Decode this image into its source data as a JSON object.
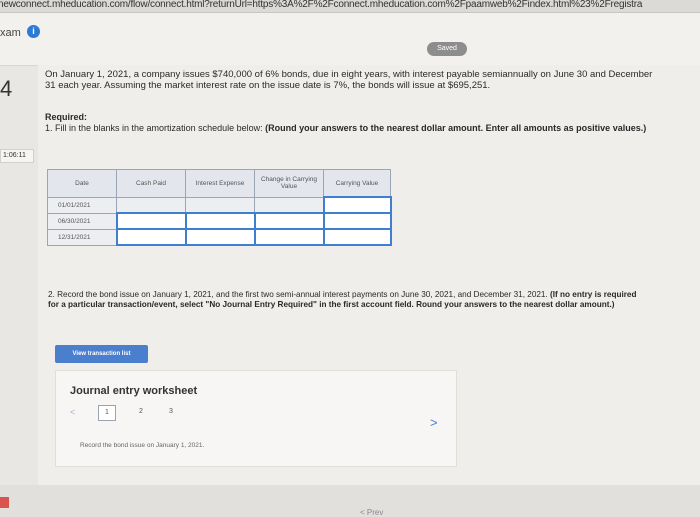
{
  "browser": {
    "url": "newconnect.mheducation.com/flow/connect.html?returnUrl=https%3A%2F%2Fconnect.mheducation.com%2Fpaamweb%2Findex.html%23%2Fregistra"
  },
  "header": {
    "exam_label": "xam",
    "info_icon": "i",
    "saved_label": "Saved"
  },
  "question": {
    "number": "4",
    "timer": "1:06:11",
    "text": "On January 1, 2021, a company issues $740,000 of 6% bonds, due in eight years, with interest payable semiannually on June 30 and December 31 each year. Assuming the market interest rate on the issue date is 7%, the bonds will issue at $695,251.",
    "required_title": "Required:",
    "required_text_plain": "1. Fill in the blanks in the amortization schedule below: ",
    "required_text_bold": "(Round your answers to the nearest dollar amount. Enter all amounts as positive values.)"
  },
  "schedule": {
    "headers": [
      "Date",
      "Cash Paid",
      "Interest Expense",
      "Change in Carrying Value",
      "Carrying Value"
    ],
    "rows": [
      "01/01/2021",
      "06/30/2021",
      "12/31/2021"
    ]
  },
  "part2": {
    "text_plain": "2. Record the bond issue on January 1, 2021, and the first two semi-annual interest payments on June 30, 2021, and December 31, 2021. ",
    "text_bold": "(If no entry is required for a particular transaction/event, select \"No Journal Entry Required\" in the first account field. Round your answers to the nearest dollar amount.)"
  },
  "journal": {
    "view_button": "View transaction list",
    "title": "Journal entry worksheet",
    "pages": [
      "1",
      "2",
      "3"
    ],
    "prev": "<",
    "next": ">",
    "hint": "Record the bond issue on January 1, 2021."
  },
  "footer": {
    "pager_hint": "< Prev"
  }
}
